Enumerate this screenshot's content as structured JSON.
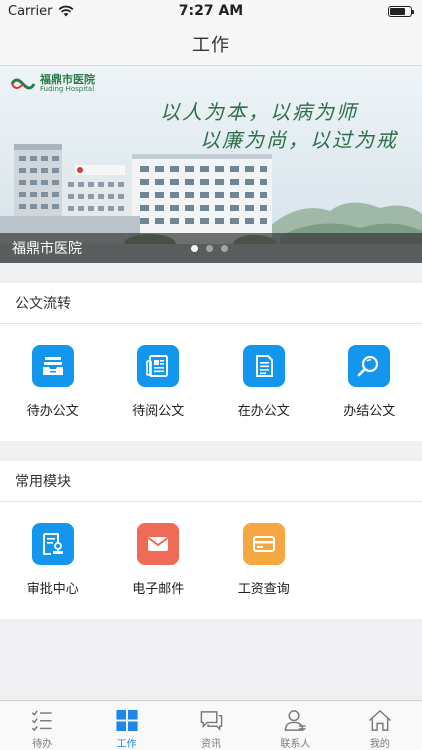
{
  "status_bar": {
    "carrier": "Carrier",
    "time": "7:27 AM",
    "battery_level": 0.75
  },
  "nav": {
    "title": "工作"
  },
  "banner": {
    "logo_cn": "福鼎市医院",
    "logo_en": "Fuding Hospital",
    "slogan_line1": "以人为本，以病为师",
    "slogan_line2": "以廉为尚，以过为戒",
    "caption": "福鼎市医院",
    "page_count": 3,
    "active_page": 1
  },
  "documents_section": {
    "title": "公文流转",
    "items": [
      {
        "label": "待办公文",
        "icon": "inbox-tray-icon",
        "color": "#1296ee"
      },
      {
        "label": "待阅公文",
        "icon": "newspaper-icon",
        "color": "#1296ee"
      },
      {
        "label": "在办公文",
        "icon": "document-icon",
        "color": "#1296ee"
      },
      {
        "label": "办结公文",
        "icon": "magnifier-icon",
        "color": "#1296ee"
      }
    ]
  },
  "modules_section": {
    "title": "常用模块",
    "items": [
      {
        "label": "审批中心",
        "icon": "approval-icon",
        "color": "#1296ee"
      },
      {
        "label": "电子邮件",
        "icon": "mail-icon",
        "color": "#ef6b57"
      },
      {
        "label": "工资查询",
        "icon": "card-icon",
        "color": "#f5a742"
      }
    ]
  },
  "tab_bar": {
    "active_color": "#1d86e8",
    "tabs": [
      {
        "label": "待办",
        "icon": "checklist-icon"
      },
      {
        "label": "工作",
        "icon": "grid-icon",
        "active": true
      },
      {
        "label": "资讯",
        "icon": "chat-icon"
      },
      {
        "label": "联系人",
        "icon": "contacts-icon"
      },
      {
        "label": "我的",
        "icon": "home-icon"
      }
    ]
  }
}
